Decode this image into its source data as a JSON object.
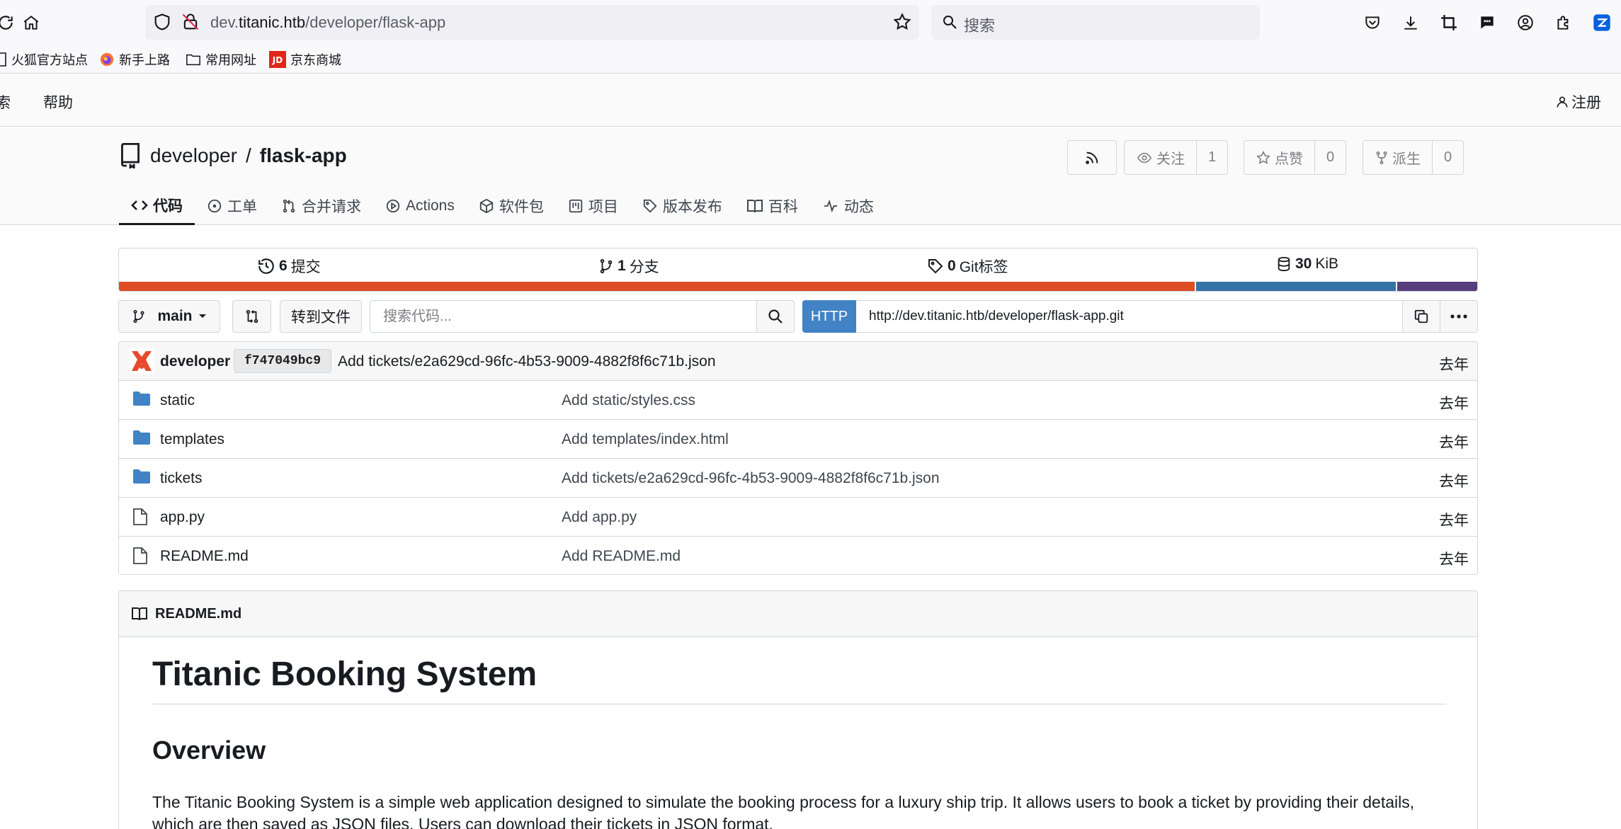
{
  "browser": {
    "url_prefix": "dev.",
    "url_host": "titanic.htb",
    "url_path": "/developer/flask-app",
    "search_placeholder": "搜索",
    "bookmarks": [
      "火狐官方站点",
      "新手上路",
      "常用网址",
      "京东商城"
    ]
  },
  "site_nav": {
    "search_partial": "索",
    "help": "帮助",
    "register": "注册"
  },
  "repo": {
    "owner": "developer",
    "separator": "/",
    "name": "flask-app",
    "watch_label": "关注",
    "watch_count": "1",
    "star_label": "点赞",
    "star_count": "0",
    "fork_label": "派生",
    "fork_count": "0",
    "tabs": [
      "代码",
      "工单",
      "合并请求",
      "Actions",
      "软件包",
      "项目",
      "版本发布",
      "百科",
      "动态"
    ]
  },
  "stats": {
    "commits_num": "6",
    "commits_label": "提交",
    "branches_num": "1",
    "branches_label": "分支",
    "tags_num": "0",
    "tags_label": "Git标签",
    "size_num": "30",
    "size_unit": "KiB",
    "languages": [
      {
        "color": "#dd4e25",
        "fraction": 0.792
      },
      {
        "color": "#3572a5",
        "fraction": 0.148
      },
      {
        "color": "#563d7c",
        "fraction": 0.06
      }
    ]
  },
  "toolbar": {
    "branch": "main",
    "goto_file": "转到文件",
    "search_placeholder": "搜索代码...",
    "protocol": "HTTP",
    "clone_url": "http://dev.titanic.htb/developer/flask-app.git"
  },
  "latest_commit": {
    "author": "developer",
    "sha": "f747049bc9",
    "message": "Add tickets/e2a629cd-96fc-4b53-9009-4882f8f6c71b.json",
    "age": "去年"
  },
  "files": [
    {
      "type": "dir",
      "name": "static",
      "message": "Add static/styles.css",
      "age": "去年"
    },
    {
      "type": "dir",
      "name": "templates",
      "message": "Add templates/index.html",
      "age": "去年"
    },
    {
      "type": "dir",
      "name": "tickets",
      "message": "Add tickets/e2a629cd-96fc-4b53-9009-4882f8f6c71b.json",
      "age": "去年"
    },
    {
      "type": "file",
      "name": "app.py",
      "message": "Add app.py",
      "age": "去年"
    },
    {
      "type": "file",
      "name": "README.md",
      "message": "Add README.md",
      "age": "去年"
    }
  ],
  "readme": {
    "filename": "README.md",
    "h1": "Titanic Booking System",
    "h2": "Overview",
    "paragraph": "The Titanic Booking System is a simple web application designed to simulate the booking process for a luxury ship trip. It allows users to book a ticket by providing their details, which are then saved as JSON files. Users can download their tickets in JSON format."
  }
}
